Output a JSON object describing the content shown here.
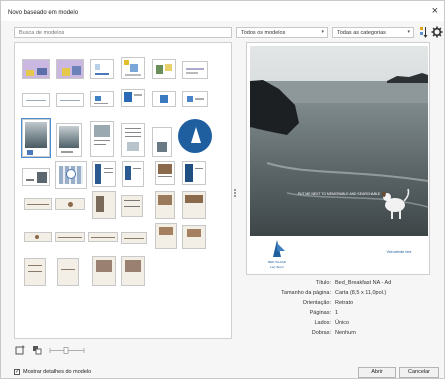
{
  "window": {
    "title": "Novo baseado em modelo",
    "close_glyph": "×"
  },
  "search": {
    "placeholder": "Busca de modelos"
  },
  "filters": {
    "models": {
      "value": "Todos os modelos"
    },
    "categories": {
      "value": "Todas as categorias"
    }
  },
  "icons": {
    "sort": "sort-icon",
    "settings": "gear-icon",
    "dropdown": "chevron-down-icon",
    "new_folder": "new-folder-icon",
    "view_toggle": "view-toggle-icon",
    "zoom": "zoom-slider-icon"
  },
  "preview": {
    "photo_caption": "PUT ME NEXT TO MEMORABLE AND SEARCHABLE",
    "logo_text": [
      "BED ISLAND",
      "Lazy Beach"
    ],
    "footer_text": "Visit website here"
  },
  "details": [
    {
      "label": "Título:",
      "value": "Bed_Breakfast NA - Ad"
    },
    {
      "label": "Tamanho da página:",
      "value": "Carta (8,5 x 11,0pol.)"
    },
    {
      "label": "Orientação:",
      "value": "Retrato"
    },
    {
      "label": "Páginas:",
      "value": "1"
    },
    {
      "label": "Lados:",
      "value": "Único"
    },
    {
      "label": "Dobras:",
      "value": "Nenhum"
    }
  ],
  "footer": {
    "show_details_label": "Mostrar detalhes do modelo",
    "show_details_checked": true,
    "open_label": "Abrir",
    "cancel_label": "Cancelar"
  },
  "colors": {
    "accent": "#4a8fd9",
    "brand_blue": "#1f5fa0",
    "sand": "#f4efe6"
  }
}
